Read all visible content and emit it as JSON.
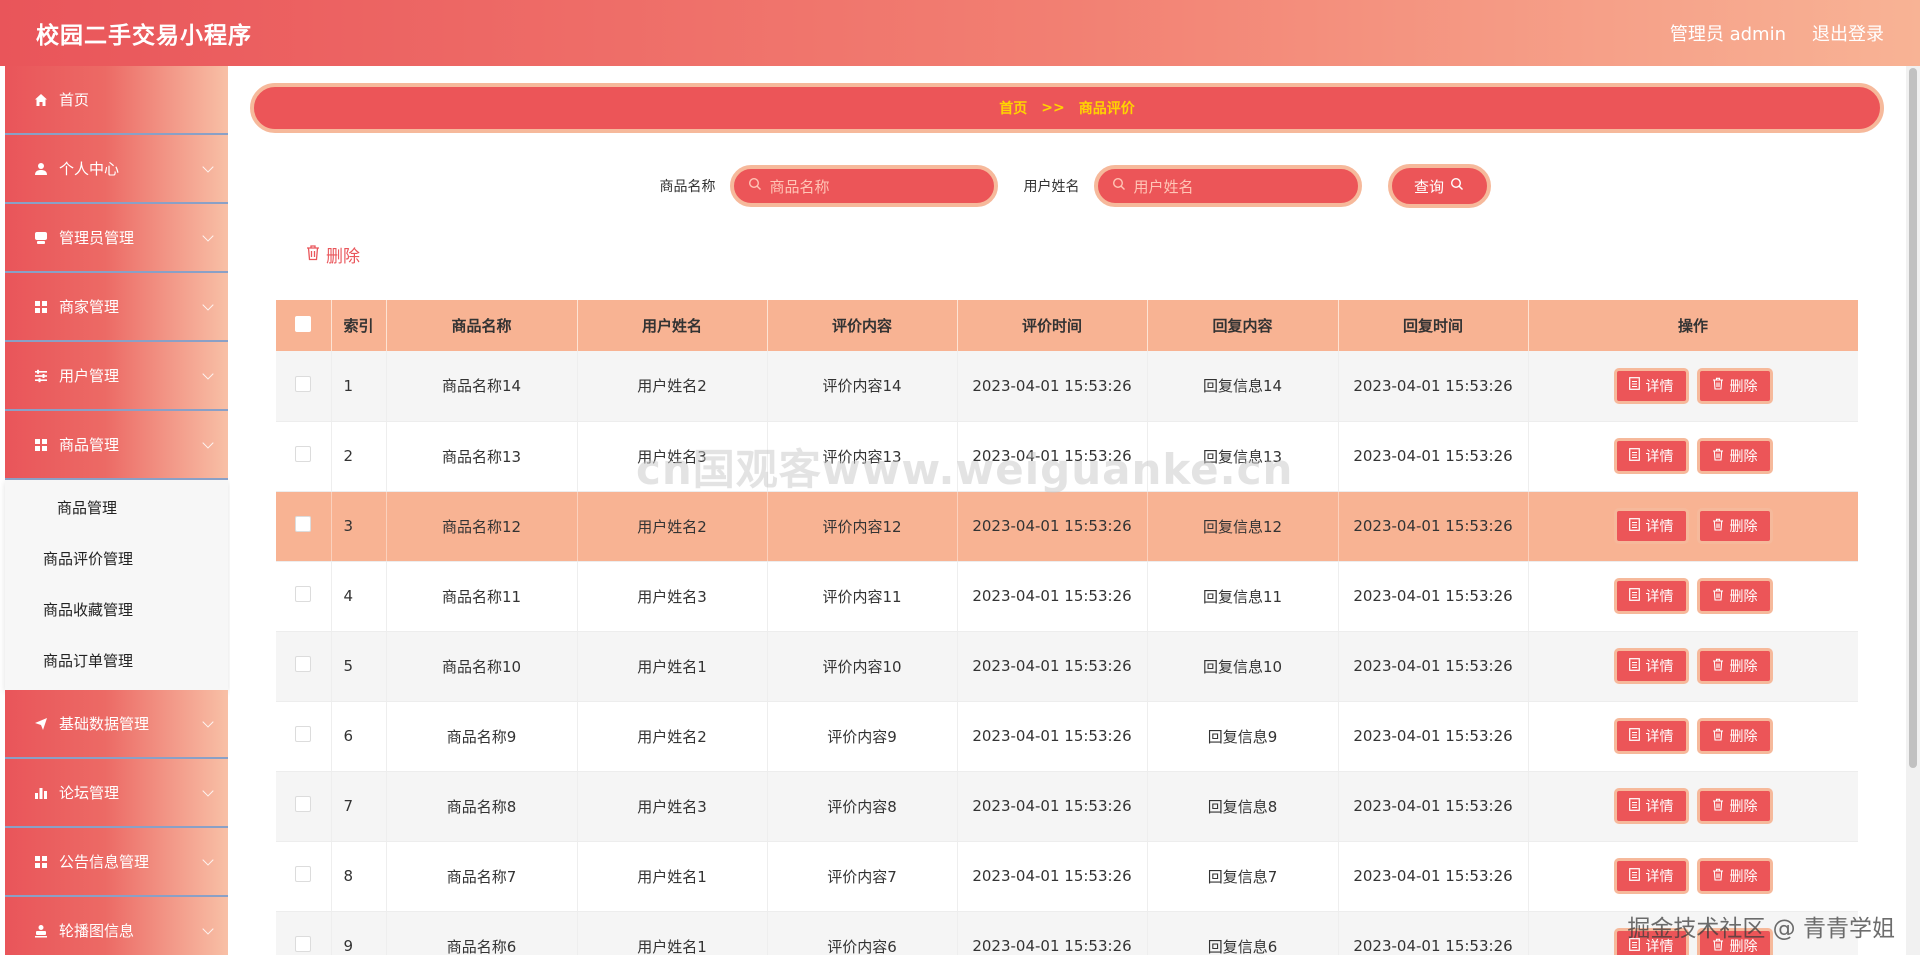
{
  "header": {
    "title": "校园二手交易小程序",
    "user": "管理员 admin",
    "logout": "退出登录"
  },
  "sidebar": {
    "items": [
      {
        "label": "首页",
        "icon": "home-icon"
      },
      {
        "label": "个人中心",
        "icon": "user-icon"
      },
      {
        "label": "管理员管理",
        "icon": "admin-icon"
      },
      {
        "label": "商家管理",
        "icon": "grid-icon"
      },
      {
        "label": "用户管理",
        "icon": "sliders-icon"
      },
      {
        "label": "商品管理",
        "icon": "grid-icon"
      }
    ],
    "submenu": [
      "商品管理",
      "商品评价管理",
      "商品收藏管理",
      "商品订单管理"
    ],
    "items_after": [
      {
        "label": "基础数据管理",
        "icon": "send-icon"
      },
      {
        "label": "论坛管理",
        "icon": "bar-chart-icon"
      },
      {
        "label": "公告信息管理",
        "icon": "grid-icon"
      },
      {
        "label": "轮播图信息",
        "icon": "person-icon"
      }
    ]
  },
  "breadcrumb": {
    "home": "首页",
    "separator": ">>",
    "current": "商品评价"
  },
  "search": {
    "product_label": "商品名称",
    "product_placeholder": "商品名称",
    "user_label": "用户姓名",
    "user_placeholder": "用户姓名",
    "query_button": "查询"
  },
  "actions": {
    "delete": "删除"
  },
  "table": {
    "columns": [
      "索引",
      "商品名称",
      "用户姓名",
      "评价内容",
      "评价时间",
      "回复内容",
      "回复时间",
      "操作"
    ],
    "detail_label": "详情",
    "delete_label": "删除",
    "rows": [
      {
        "index": "1",
        "product": "商品名称14",
        "user": "用户姓名2",
        "content": "评价内容14",
        "time": "2023-04-01 15:53:26",
        "reply": "回复信息14",
        "reply_time": "2023-04-01 15:53:26"
      },
      {
        "index": "2",
        "product": "商品名称13",
        "user": "用户姓名3",
        "content": "评价内容13",
        "time": "2023-04-01 15:53:26",
        "reply": "回复信息13",
        "reply_time": "2023-04-01 15:53:26"
      },
      {
        "index": "3",
        "product": "商品名称12",
        "user": "用户姓名2",
        "content": "评价内容12",
        "time": "2023-04-01 15:53:26",
        "reply": "回复信息12",
        "reply_time": "2023-04-01 15:53:26"
      },
      {
        "index": "4",
        "product": "商品名称11",
        "user": "用户姓名3",
        "content": "评价内容11",
        "time": "2023-04-01 15:53:26",
        "reply": "回复信息11",
        "reply_time": "2023-04-01 15:53:26"
      },
      {
        "index": "5",
        "product": "商品名称10",
        "user": "用户姓名1",
        "content": "评价内容10",
        "time": "2023-04-01 15:53:26",
        "reply": "回复信息10",
        "reply_time": "2023-04-01 15:53:26"
      },
      {
        "index": "6",
        "product": "商品名称9",
        "user": "用户姓名2",
        "content": "评价内容9",
        "time": "2023-04-01 15:53:26",
        "reply": "回复信息9",
        "reply_time": "2023-04-01 15:53:26"
      },
      {
        "index": "7",
        "product": "商品名称8",
        "user": "用户姓名3",
        "content": "评价内容8",
        "time": "2023-04-01 15:53:26",
        "reply": "回复信息8",
        "reply_time": "2023-04-01 15:53:26"
      },
      {
        "index": "8",
        "product": "商品名称7",
        "user": "用户姓名1",
        "content": "评价内容7",
        "time": "2023-04-01 15:53:26",
        "reply": "回复信息7",
        "reply_time": "2023-04-01 15:53:26"
      },
      {
        "index": "9",
        "product": "商品名称6",
        "user": "用户姓名1",
        "content": "评价内容6",
        "time": "2023-04-01 15:53:26",
        "reply": "回复信息6",
        "reply_time": "2023-04-01 15:53:26"
      }
    ]
  },
  "watermark": "cn国观客www.weiguanke.cn",
  "corner_watermark": "掘金技术社区 @ 青青学姐",
  "colors": {
    "primary": "#ec5558",
    "accent": "#f8b393",
    "breadcrumb_text": "#ffd400"
  }
}
